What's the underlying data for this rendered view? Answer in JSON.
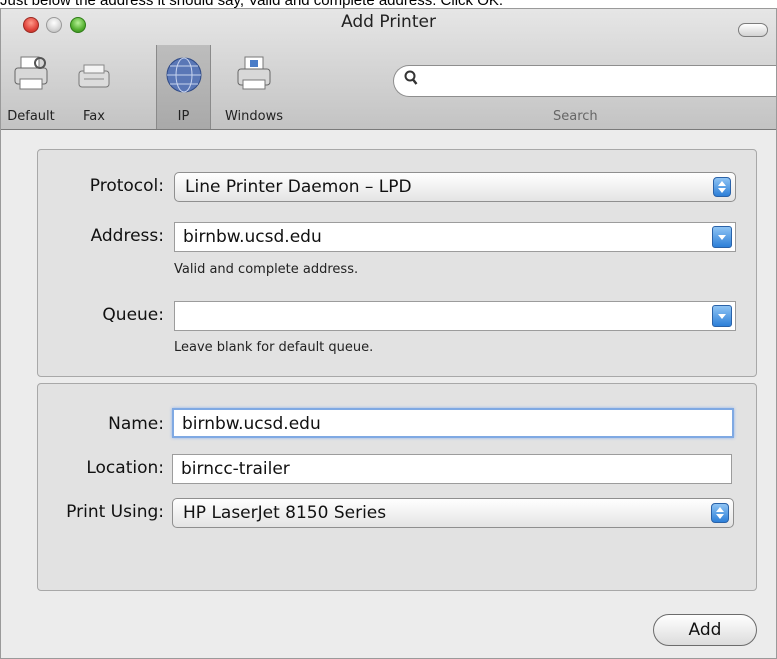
{
  "caption": "Just below the address it should say, Valid and complete address. Click OK.",
  "window": {
    "title": "Add Printer"
  },
  "toolbar": {
    "items": [
      {
        "label": "Default",
        "icon": "printer-icon"
      },
      {
        "label": "Fax",
        "icon": "fax-icon"
      },
      {
        "label": "IP",
        "icon": "globe-icon"
      },
      {
        "label": "Windows",
        "icon": "windows-printer-icon"
      }
    ],
    "search_label": "Search",
    "search_value": ""
  },
  "connection": {
    "protocol_label": "Protocol:",
    "protocol_value": "Line Printer Daemon – LPD",
    "address_label": "Address:",
    "address_value": "birnbw.ucsd.edu",
    "address_hint": "Valid and complete address.",
    "queue_label": "Queue:",
    "queue_value": "",
    "queue_hint": "Leave blank for default queue."
  },
  "details": {
    "name_label": "Name:",
    "name_value": "birnbw.ucsd.edu",
    "location_label": "Location:",
    "location_value": "birncc-trailer",
    "print_using_label": "Print Using:",
    "print_using_value": "HP LaserJet 8150 Series"
  },
  "actions": {
    "add_label": "Add"
  },
  "colors": {
    "accent": "#2d7fd8",
    "focus_ring": "#7fa9e3",
    "close": "#e0443b",
    "zoom": "#54b030"
  }
}
